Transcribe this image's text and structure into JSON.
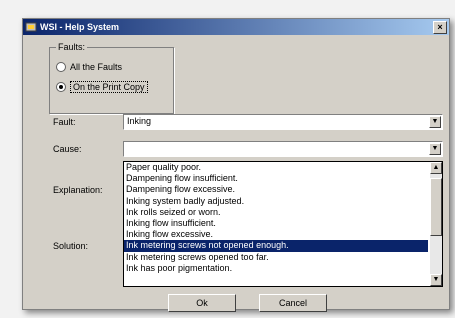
{
  "window": {
    "title": "WSI - Help System",
    "close_glyph": "×"
  },
  "faults_group": {
    "legend": "Faults:",
    "options": [
      {
        "label": "All the Faults",
        "checked": false
      },
      {
        "label": "On the Print Copy",
        "checked": true
      }
    ]
  },
  "fault": {
    "label": "Fault:",
    "value": "Inking"
  },
  "cause": {
    "label": "Cause:",
    "value": "",
    "dropdown_items": [
      "Paper quality poor.",
      "Dampening flow insufficient.",
      "Dampening flow excessive.",
      "Inking system badly adjusted.",
      "Ink rolls seized or worn.",
      "Inking flow insufficient.",
      "Inking flow excessive.",
      "Ink metering screws not opened enough.",
      "Ink metering screws opened too far.",
      "Ink has poor pigmentation."
    ],
    "selected_index": 7
  },
  "explanation": {
    "label": "Explanation:"
  },
  "solution": {
    "label": "Solution:"
  },
  "buttons": {
    "ok": "Ok",
    "cancel": "Cancel"
  },
  "icons": {
    "drop": "▼",
    "up": "▲",
    "down": "▼"
  }
}
